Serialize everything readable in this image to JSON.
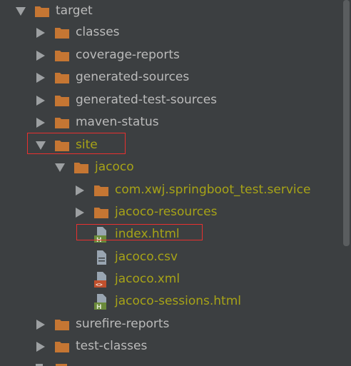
{
  "tree": {
    "items": [
      {
        "label": "target",
        "kind": "folder",
        "expanded": true,
        "color": "#bbbbbb"
      },
      {
        "label": "classes",
        "kind": "folder",
        "expanded": false,
        "color": "#bbbbbb"
      },
      {
        "label": "coverage-reports",
        "kind": "folder",
        "expanded": false,
        "color": "#bbbbbb"
      },
      {
        "label": "generated-sources",
        "kind": "folder",
        "expanded": false,
        "color": "#bbbbbb"
      },
      {
        "label": "generated-test-sources",
        "kind": "folder",
        "expanded": false,
        "color": "#bbbbbb"
      },
      {
        "label": "maven-status",
        "kind": "folder",
        "expanded": false,
        "color": "#bbbbbb"
      },
      {
        "label": "site",
        "kind": "folder",
        "expanded": true,
        "color": "#a7a317",
        "highlighted": true
      },
      {
        "label": "jacoco",
        "kind": "folder",
        "expanded": true,
        "color": "#a7a317"
      },
      {
        "label": "com.xwj.springboot_test.service",
        "kind": "folder",
        "expanded": false,
        "color": "#a7a317"
      },
      {
        "label": "jacoco-resources",
        "kind": "folder",
        "expanded": false,
        "color": "#a7a317"
      },
      {
        "label": "index.html",
        "kind": "html-file",
        "color": "#a7a317",
        "highlighted": true
      },
      {
        "label": "jacoco.csv",
        "kind": "csv-file",
        "color": "#a7a317"
      },
      {
        "label": "jacoco.xml",
        "kind": "xml-file",
        "color": "#a7a317"
      },
      {
        "label": "jacoco-sessions.html",
        "kind": "html-file",
        "color": "#a7a317"
      },
      {
        "label": "surefire-reports",
        "kind": "folder",
        "expanded": false,
        "color": "#bbbbbb"
      },
      {
        "label": "test-classes",
        "kind": "folder",
        "expanded": false,
        "color": "#bbbbbb"
      }
    ]
  },
  "colors": {
    "background": "#3c3f41",
    "folder": "#c57633",
    "text_default": "#bbbbbb",
    "text_excluded": "#a7a317",
    "highlight_box": "#e8302f",
    "html_badge": "#6a8a3a",
    "xml_badge": "#c0502d"
  },
  "icons": {
    "expanded": "triangle-down-icon",
    "collapsed": "triangle-right-icon",
    "folder": "folder-icon",
    "html": "html-file-icon",
    "csv": "text-file-icon",
    "xml": "xml-file-icon"
  }
}
